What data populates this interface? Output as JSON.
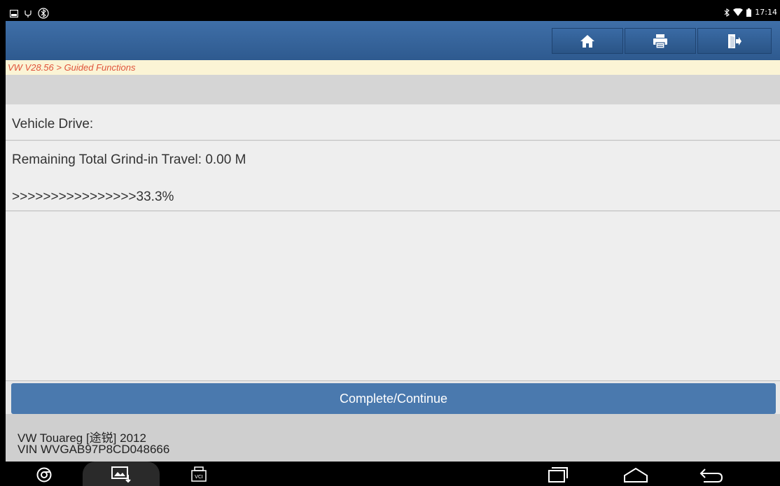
{
  "status_bar": {
    "time": "17:14",
    "left_icons": [
      "screenshot-icon",
      "usb-debug-icon",
      "bluetooth-circle-icon"
    ],
    "right_icons": [
      "bluetooth-icon",
      "wifi-icon",
      "battery-icon"
    ]
  },
  "header": {
    "buttons": [
      {
        "name": "home-button",
        "icon": "home-icon"
      },
      {
        "name": "print-button",
        "icon": "printer-icon"
      },
      {
        "name": "exit-button",
        "icon": "exit-icon"
      }
    ]
  },
  "breadcrumb": "VW V28.56 > Guided Functions",
  "content": {
    "vehicle_drive_label": "Vehicle Drive:",
    "remaining_travel": "Remaining Total Grind-in Travel: 0.00 M",
    "progress_text": ">>>>>>>>>>>>>>>>33.3%"
  },
  "action": {
    "complete_label": "Complete/Continue"
  },
  "vehicle": {
    "model": "VW Touareg [途锐] 2012",
    "vin": "VIN WVGAB97P8CD048666"
  },
  "nav_bar": {
    "left_icons": [
      "chrome-icon",
      "gallery-download-icon",
      "vci-icon"
    ],
    "right_icons": [
      "recent-apps-icon",
      "home-nav-icon",
      "back-icon"
    ]
  },
  "colors": {
    "header_blue": "#2e5a8f",
    "button_blue": "#4a79ae",
    "breadcrumb_text": "#e0533a",
    "breadcrumb_bg": "#fbf4d5"
  }
}
